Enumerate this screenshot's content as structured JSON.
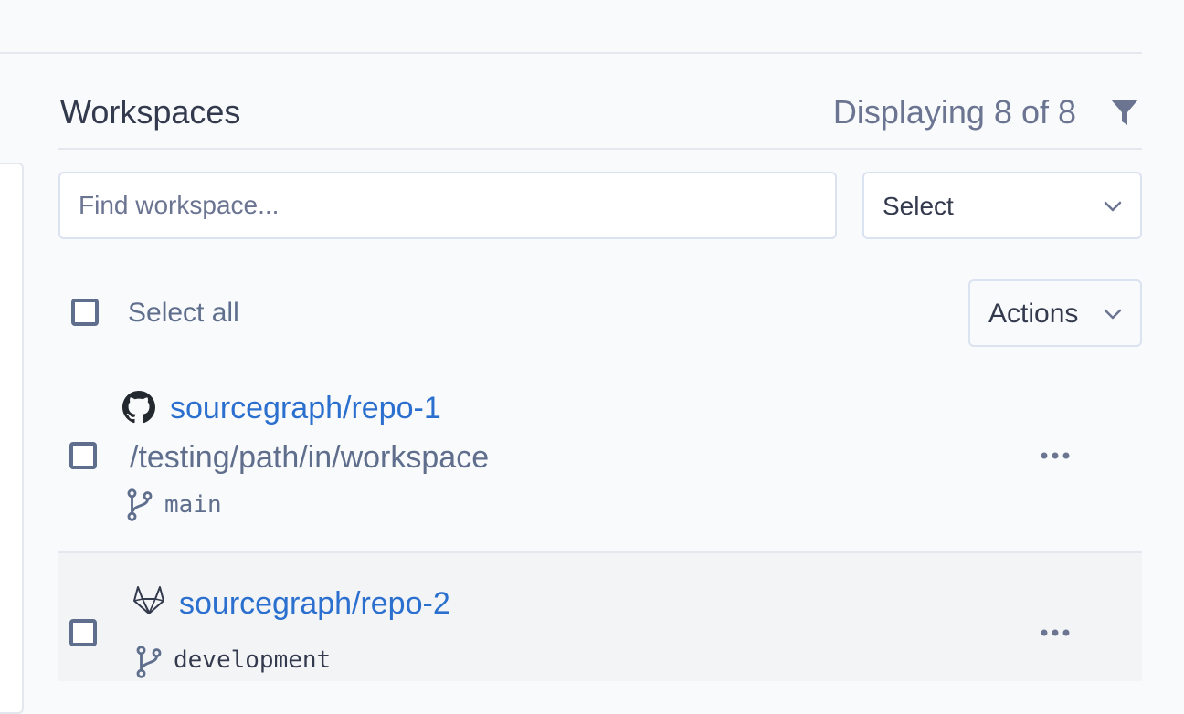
{
  "header": {
    "title": "Workspaces",
    "count_text": "Displaying 8 of 8",
    "filter_icon": "filter-icon"
  },
  "search": {
    "placeholder": "Find workspace...",
    "value": ""
  },
  "select": {
    "value": "Select",
    "icon": "chevron-down-icon"
  },
  "bulk": {
    "select_all_label": "Select all",
    "actions_label": "Actions"
  },
  "workspaces": [
    {
      "host": "github-icon",
      "repo": "sourcegraph/repo-1",
      "path": "/testing/path/in/workspace",
      "branch": "main",
      "checked": false,
      "menu_icon": "more-icon"
    },
    {
      "host": "gitlab-icon",
      "repo": "sourcegraph/repo-2",
      "path": "",
      "branch": "development",
      "checked": false,
      "menu_icon": "more-icon"
    }
  ],
  "colors": {
    "link": "#2b6fcf",
    "muted": "#5e6e8c",
    "text": "#343a4d",
    "border": "#dbe2f0",
    "background": "#f9fafb"
  }
}
